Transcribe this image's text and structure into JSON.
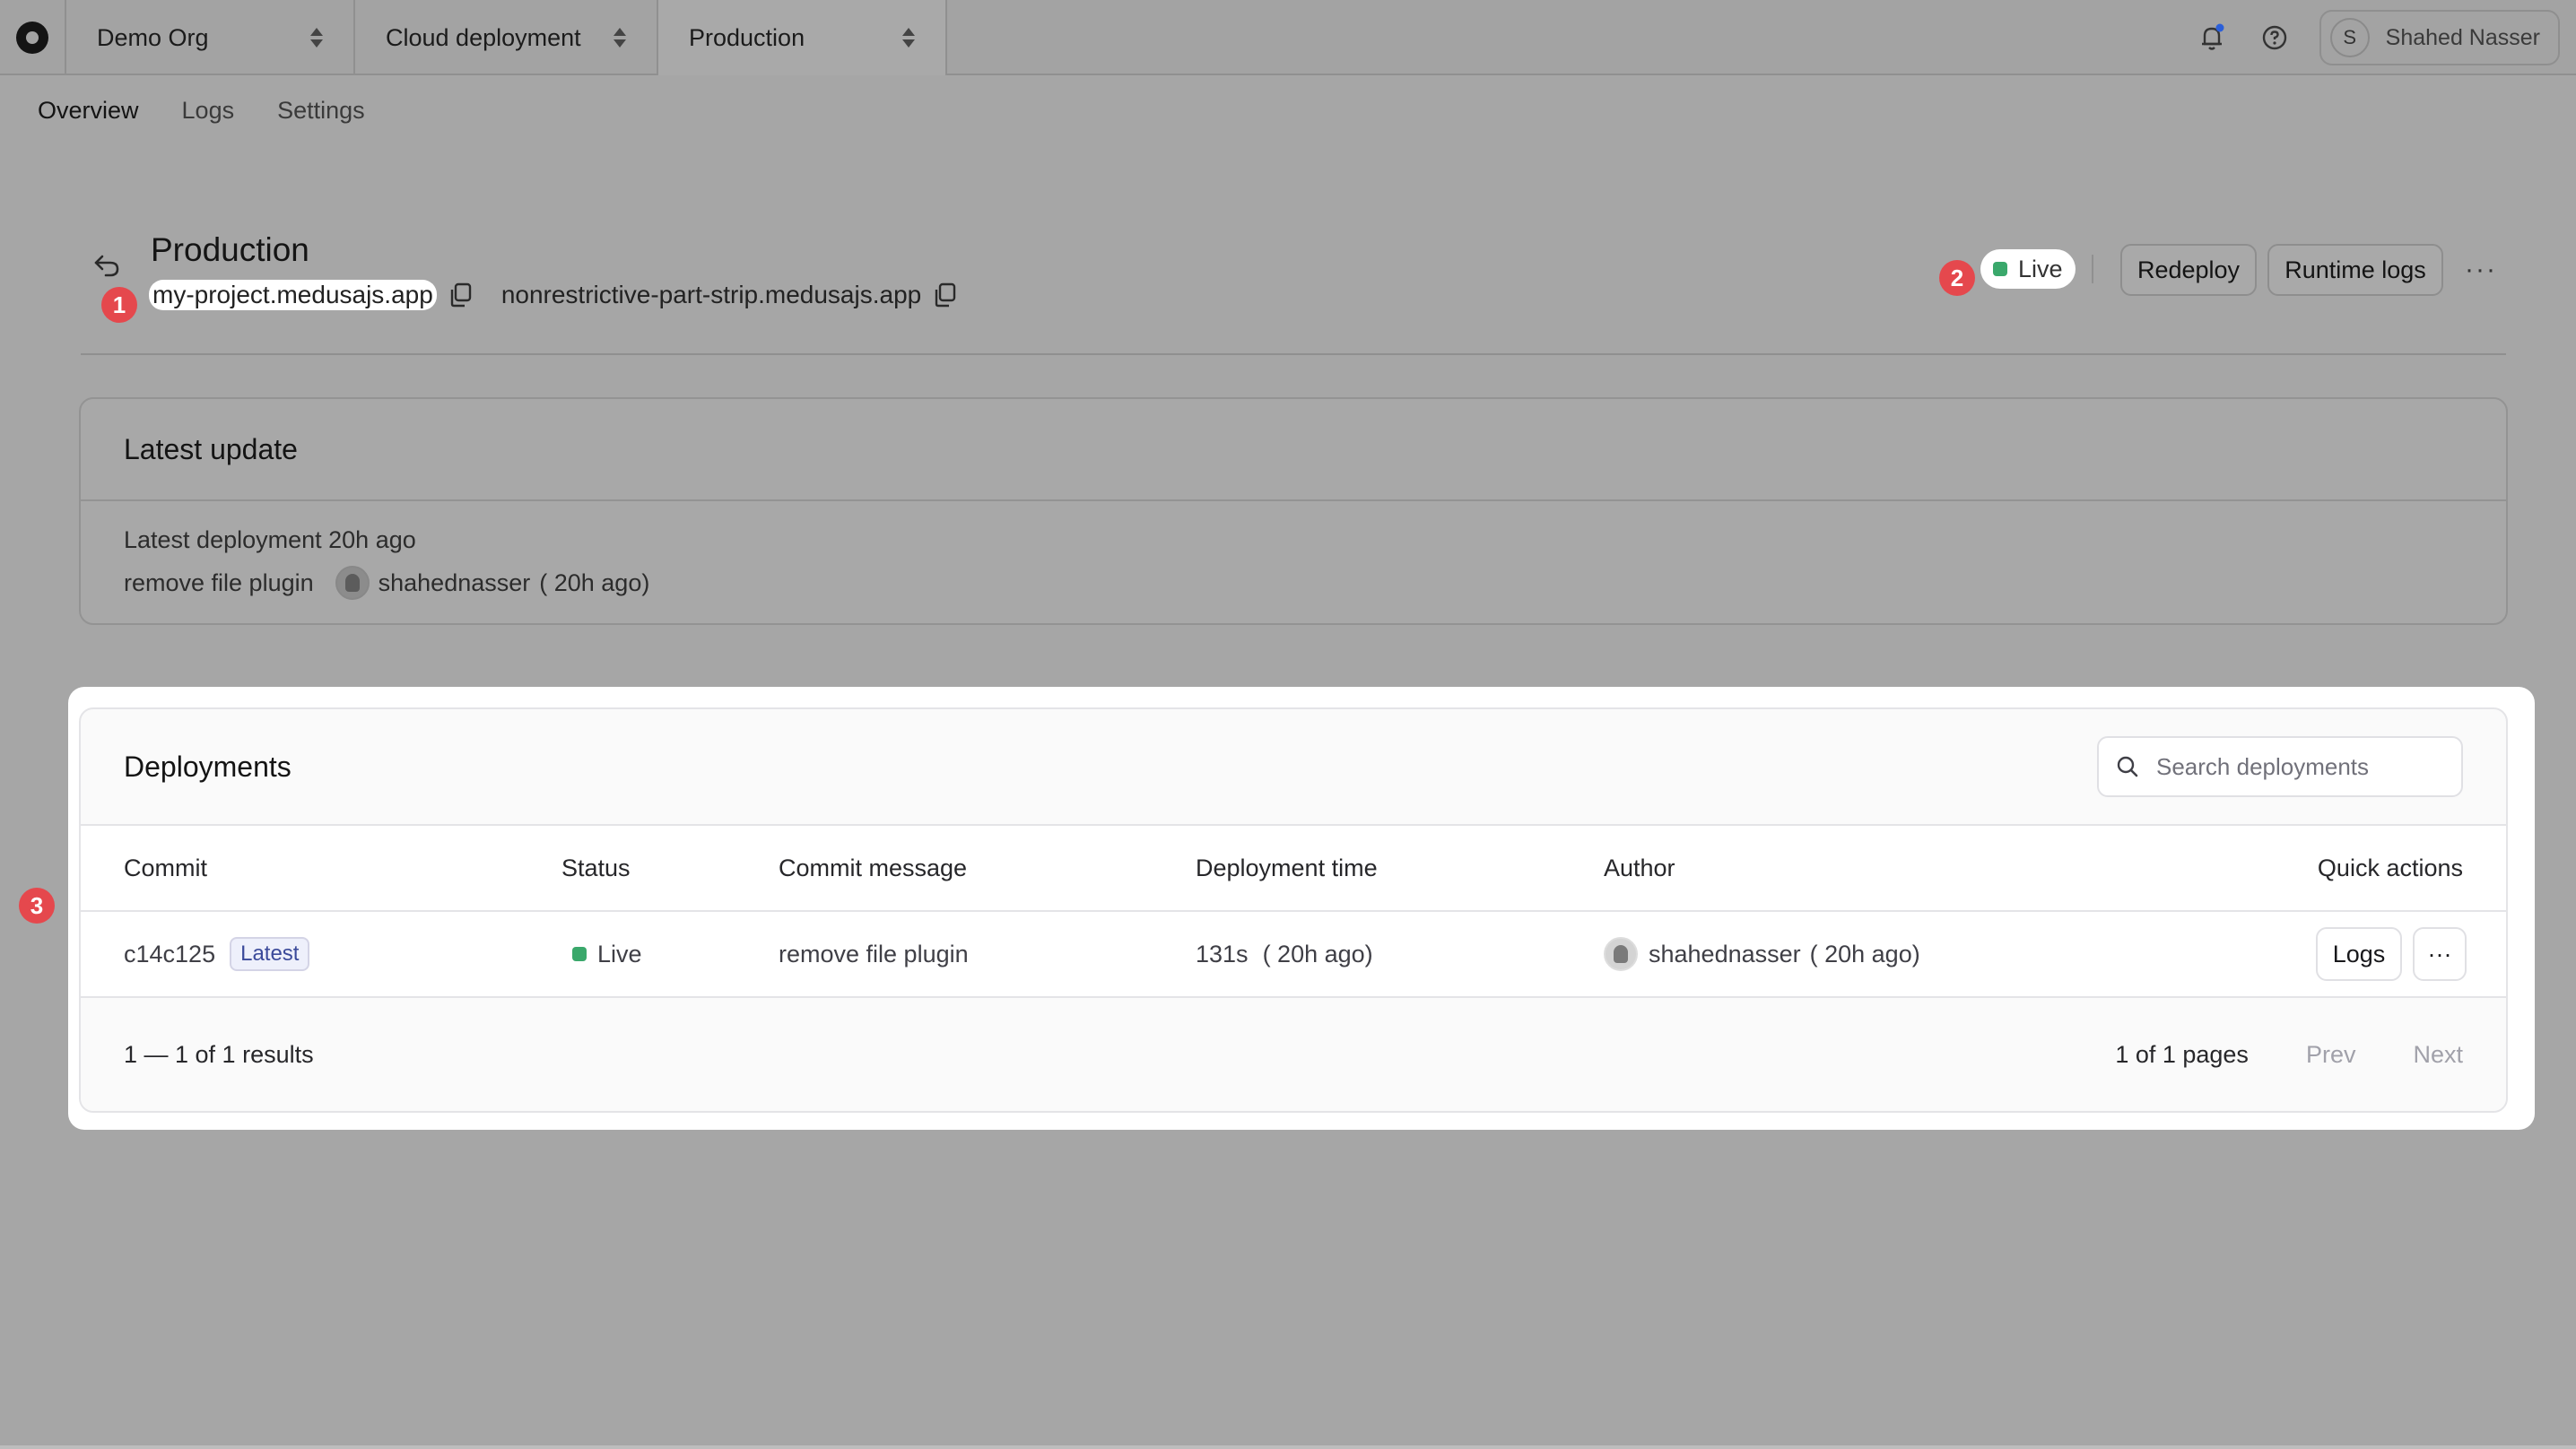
{
  "topbar": {
    "org": "Demo Org",
    "project": "Cloud deployment",
    "environment": "Production",
    "user_initial": "S",
    "user_name": "Shahed Nasser",
    "icons": [
      "bell-icon",
      "help-icon"
    ]
  },
  "tabs": [
    {
      "label": "Overview",
      "active": true
    },
    {
      "label": "Logs",
      "active": false
    },
    {
      "label": "Settings",
      "active": false
    }
  ],
  "header": {
    "title": "Production",
    "url_primary": "my-project.medusajs.app",
    "url_secondary": "nonrestrictive-part-strip.medusajs.app",
    "status": "Live",
    "redeploy_label": "Redeploy",
    "runtime_logs_label": "Runtime logs",
    "more_label": "···"
  },
  "markers": [
    "1",
    "2",
    "3"
  ],
  "latest_update": {
    "title": "Latest update",
    "deployment_line": "Latest deployment 20h ago",
    "commit_message": "remove file plugin",
    "author": "shahednasser",
    "author_time": "( 20h ago)"
  },
  "deployments": {
    "title": "Deployments",
    "search_placeholder": "Search deployments",
    "columns": {
      "commit": "Commit",
      "status": "Status",
      "message": "Commit message",
      "time": "Deployment time",
      "author": "Author",
      "actions": "Quick actions"
    },
    "rows": [
      {
        "commit": "c14c125",
        "badge": "Latest",
        "status": "Live",
        "message": "remove file plugin",
        "duration": "131s",
        "time_ago": "( 20h ago)",
        "author": "shahednasser",
        "author_time": "( 20h ago)",
        "logs_label": "Logs",
        "more_label": "···"
      }
    ],
    "results": "1 — 1 of 1 results",
    "pages": "1 of 1 pages",
    "prev": "Prev",
    "next": "Next"
  },
  "colors": {
    "live": "#3aa86b",
    "marker": "#e5484d",
    "backdrop": "#a6a6a6"
  }
}
